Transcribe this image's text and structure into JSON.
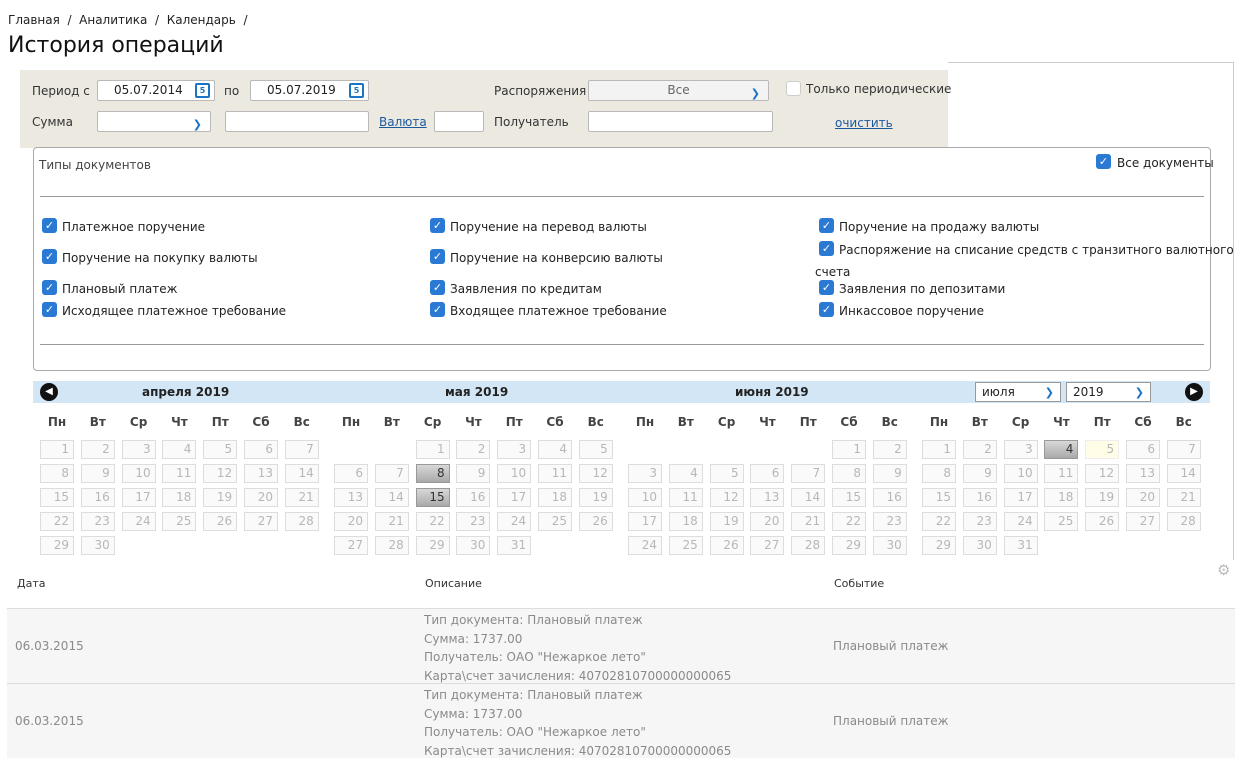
{
  "breadcrumb": "Главная  /  Аналитика  /  Календарь  /",
  "page_title": "История операций",
  "filters": {
    "period_from_label": "Период с",
    "period_from_value": "05.07.2014",
    "period_to_label": "по",
    "period_to_value": "05.07.2019",
    "orders_label": "Распоряжения",
    "orders_value": "Все",
    "only_periodic_label": "Только периодические",
    "only_periodic_checked": false,
    "sum_label": "Сумма",
    "sum_select_value": "",
    "sum_value": "",
    "currency_link": "Валюта",
    "currency_value": "",
    "recipient_label": "Получатель",
    "recipient_value": "",
    "clear_link": "очистить"
  },
  "doc_types": {
    "title": "Типы документов",
    "all_label": "Все документы",
    "items": [
      {
        "label": "Платежное поручение",
        "checked": true
      },
      {
        "label": "Поручение на перевод валюты",
        "checked": true
      },
      {
        "label": "Поручение на продажу валюты",
        "checked": true
      },
      {
        "label": "Поручение на покупку валюты",
        "checked": true
      },
      {
        "label": "Поручение на конверсию валюты",
        "checked": true
      },
      {
        "label": "Распоряжение на списание средств с транзитного валютного",
        "label2": "счета",
        "checked": true
      },
      {
        "label": "Плановый платеж",
        "checked": true
      },
      {
        "label": "Заявления по кредитам",
        "checked": true
      },
      {
        "label": "Заявления по депозитами",
        "checked": true
      },
      {
        "label": "Исходящее платежное требование",
        "checked": true
      },
      {
        "label": "Входящее платежное требование",
        "checked": true
      },
      {
        "label": "Инкассовое поручение",
        "checked": true
      }
    ]
  },
  "calendar": {
    "months": [
      "апреля 2019",
      "мая 2019",
      "июня 2019"
    ],
    "month_select": "июля",
    "year_select": "2019",
    "weekdays": [
      "Пн",
      "Вт",
      "Ср",
      "Чт",
      "Пт",
      "Сб",
      "Вс"
    ],
    "grids": [
      {
        "first_weekday": 0,
        "days": 30,
        "selected": [],
        "today": []
      },
      {
        "first_weekday": 2,
        "days": 31,
        "selected": [
          8,
          15
        ],
        "today": []
      },
      {
        "first_weekday": 5,
        "days": 30,
        "selected": [],
        "today": []
      },
      {
        "first_weekday": 0,
        "days": 31,
        "selected": [
          4
        ],
        "today": [
          5
        ]
      }
    ]
  },
  "table": {
    "columns": [
      "Дата",
      "Описание",
      "Событие"
    ],
    "rows": [
      {
        "date": "06.03.2015",
        "desc": [
          "Тип документа: Плановый платеж",
          "Сумма: 1737.00",
          "Получатель: ОАО \"Нежаркое лето\"",
          "Карта\\счет зачисления: 40702810700000000065"
        ],
        "event": "Плановый платеж"
      },
      {
        "date": "06.03.2015",
        "desc": [
          "Тип документа: Плановый платеж",
          "Сумма: 1737.00",
          "Получатель: ОАО \"Нежаркое лето\"",
          "Карта\\счет зачисления: 40702810700000000065"
        ],
        "event": "Плановый платеж"
      }
    ]
  }
}
